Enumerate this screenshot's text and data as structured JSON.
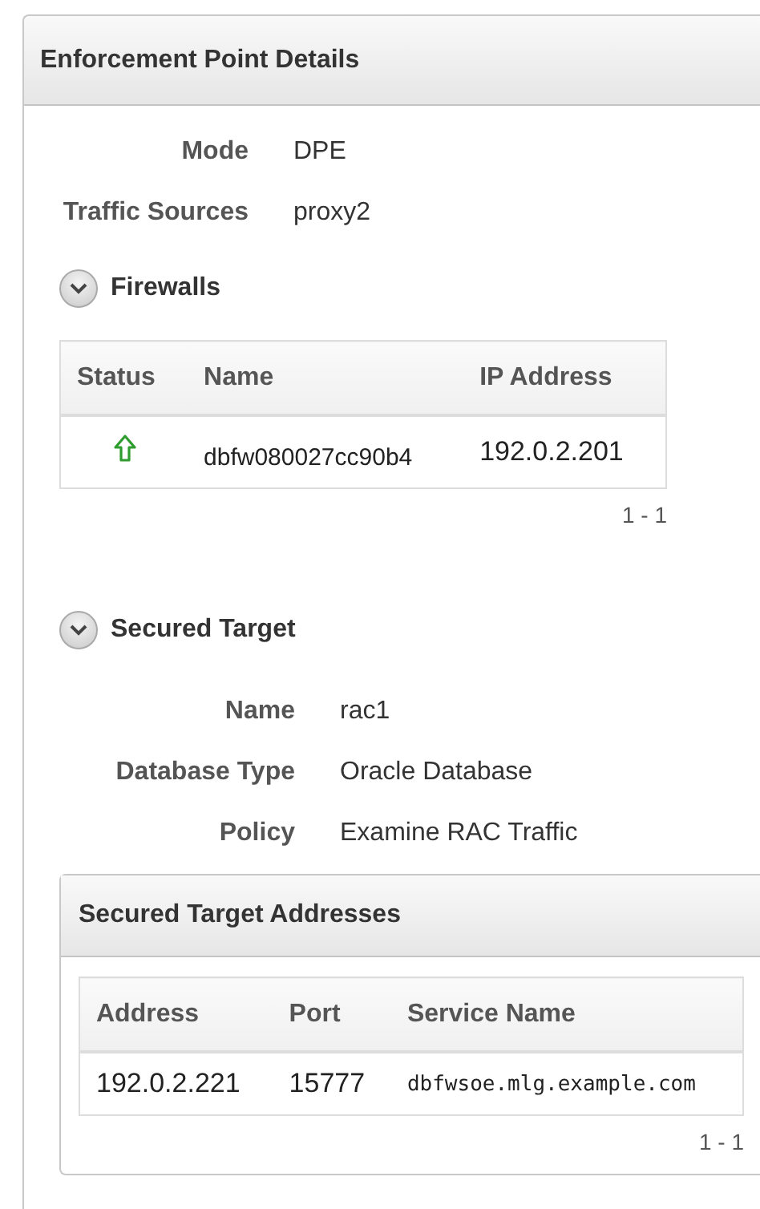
{
  "panel": {
    "title": "Enforcement Point Details"
  },
  "details": [
    {
      "label": "Mode",
      "value": "DPE"
    },
    {
      "label": "Traffic Sources",
      "value": "proxy2"
    }
  ],
  "firewalls": {
    "title": "Firewalls",
    "expanded": true,
    "columns": [
      "Status",
      "Name",
      "IP Address"
    ],
    "rows": [
      {
        "kind": "up",
        "name": "dbfw080027cc90b4",
        "ip": "192.0.2.201"
      }
    ],
    "range": "1 - 1"
  },
  "secured_target": {
    "title": "Secured Target",
    "expanded": true,
    "details": [
      {
        "label": "Name",
        "value": "rac1"
      },
      {
        "label": "Database Type",
        "value": "Oracle Database"
      },
      {
        "label": "Policy",
        "value": "Examine RAC Traffic"
      }
    ],
    "addresses": {
      "title": "Secured Target Addresses",
      "columns": [
        "Address",
        "Port",
        "Service Name"
      ],
      "rows": [
        {
          "address": "192.0.2.221",
          "port": "15777",
          "service": "dbfwsoe.mlg.example.com"
        }
      ],
      "range": "1 - 1"
    }
  }
}
